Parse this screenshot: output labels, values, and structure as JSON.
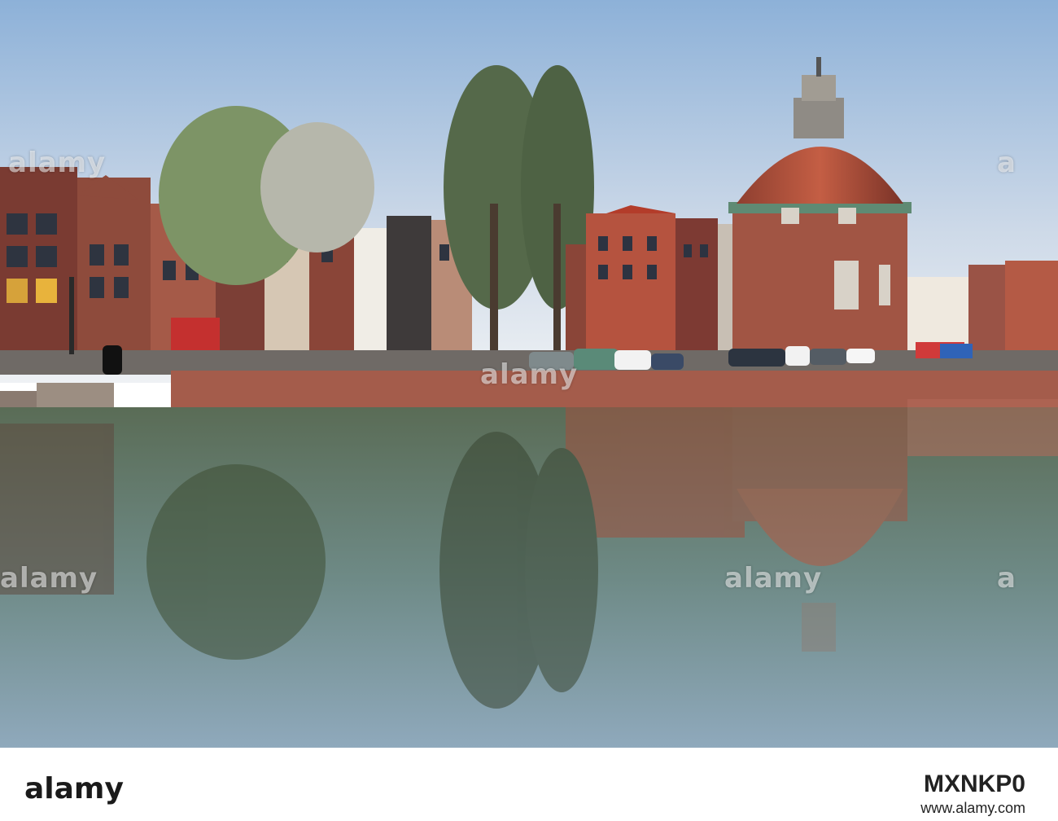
{
  "image": {
    "description_icon": "photo",
    "colors": {
      "sky_top": "#8fb2d6",
      "sky_bottom": "#e9edf3",
      "water": "#4a6b55",
      "dome": "#b4533c",
      "brick": "#8e4a3a"
    }
  },
  "watermarks": [
    "alamy",
    "alamy",
    "alamy",
    "alamy",
    "a",
    "a"
  ],
  "footer": {
    "logo_text": "alamy",
    "stock_id": "MXNKP0",
    "site": "www.alamy.com"
  }
}
